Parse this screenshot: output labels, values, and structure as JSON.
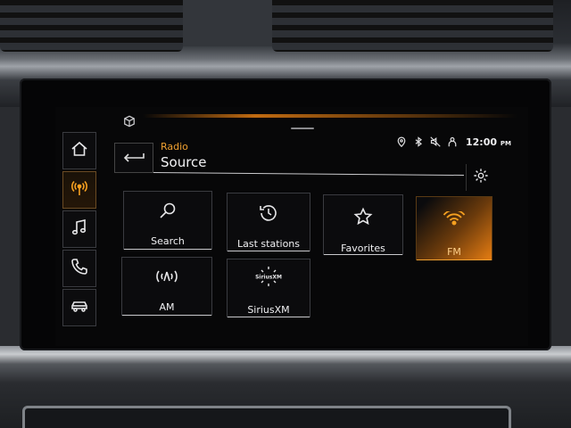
{
  "header": {
    "kicker": "Radio",
    "title": "Source"
  },
  "status": {
    "time": "12:00",
    "ampm": "PM",
    "icons": [
      "location-pin-icon",
      "bluetooth-icon",
      "mute-icon",
      "user-icon"
    ]
  },
  "sidenav": {
    "items": [
      {
        "name": "home",
        "icon": "home-icon",
        "active": false
      },
      {
        "name": "radio",
        "icon": "radio-antenna-icon",
        "active": true
      },
      {
        "name": "music",
        "icon": "music-note-icon",
        "active": false
      },
      {
        "name": "phone",
        "icon": "phone-icon",
        "active": false
      },
      {
        "name": "car",
        "icon": "car-icon",
        "active": false
      }
    ]
  },
  "tiles": [
    {
      "label": "Search",
      "icon": "search-icon",
      "active": false
    },
    {
      "label": "Last stations",
      "icon": "history-icon",
      "active": false
    },
    {
      "label": "Favorites",
      "icon": "star-icon",
      "active": false
    },
    {
      "label": "FM",
      "icon": "fm-signal-icon",
      "active": true
    },
    {
      "label": "AM",
      "icon": "am-signal-icon",
      "active": false
    },
    {
      "label": "SiriusXM",
      "icon": "siriusxm-logo-icon",
      "active": false
    }
  ],
  "colors": {
    "accent": "#f0a030",
    "background": "#070708"
  }
}
